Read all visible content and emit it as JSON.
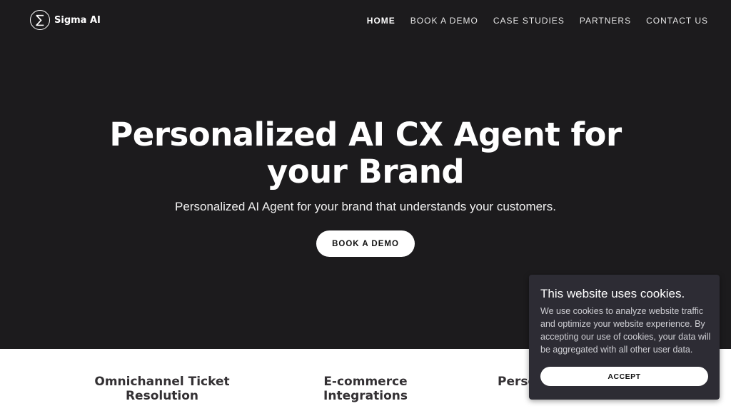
{
  "header": {
    "logo_symbol": "∑",
    "logo_text": "Sigma AI",
    "nav": [
      {
        "label": "HOME",
        "active": true
      },
      {
        "label": "BOOK A DEMO"
      },
      {
        "label": "CASE STUDIES"
      },
      {
        "label": "PARTNERS"
      },
      {
        "label": "CONTACT US"
      }
    ]
  },
  "hero": {
    "title_line1": "Personalized AI CX Agent for",
    "title_line2": "your Brand",
    "subtitle": "Personalized AI Agent for your brand that understands your customers.",
    "cta_label": "BOOK A DEMO"
  },
  "features": [
    {
      "title_line1": "Omnichannel Ticket",
      "title_line2": "Resolution"
    },
    {
      "title_line1": "E-commerce Integrations"
    },
    {
      "title_line1": "Perso"
    }
  ],
  "cookie_banner": {
    "title": "This website uses cookies.",
    "text": "We use cookies to analyze website traffic and optimize your website experience. By accepting our use of cookies, your data will be aggregated with all other user data.",
    "accept_label": "ACCEPT"
  },
  "colors": {
    "hero_background": "#1c1b1d",
    "cookie_background": "#2d2c34",
    "accent_button": "#ffffff"
  }
}
